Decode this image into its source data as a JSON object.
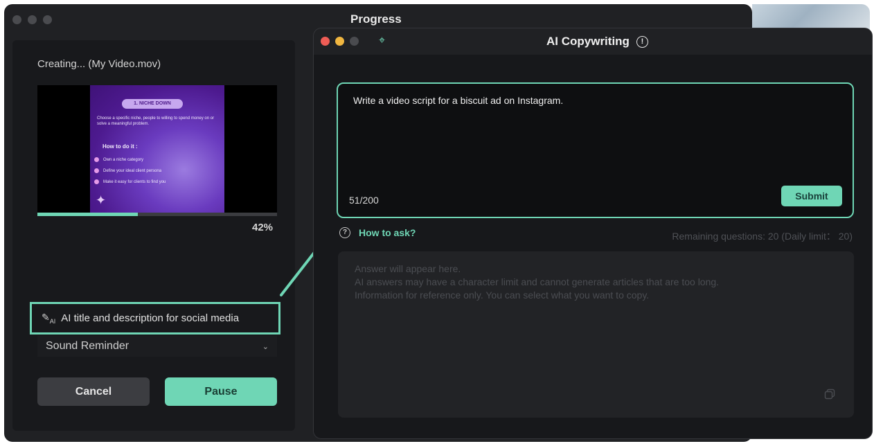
{
  "progress_window": {
    "title": "Progress",
    "creating_label": "Creating... (My Video.mov)",
    "progress_percent": "42%",
    "progress_value": 0.42,
    "preview_slide": {
      "heading": "1. NICHE DOWN",
      "body": "Choose a specific niche, people to willing to spend money on or solve a meaningful problem.",
      "subheading": "How to do it :",
      "bullets": [
        "Own a niche category",
        "Define your ideal client persona",
        "Make it easy for clients to find you"
      ]
    },
    "ai_social_label": "AI title and description for social media",
    "ai_icon_sub": "AI",
    "sound_select_value": "Sound Reminder",
    "cancel_label": "Cancel",
    "pause_label": "Pause"
  },
  "copywriting_window": {
    "title": "AI Copywriting",
    "prompt_text": "Write a video script for a biscuit ad on Instagram.",
    "char_count": "51/200",
    "submit_label": "Submit",
    "how_to_ask_label": "How to ask?",
    "remaining_text": "Remaining questions: 20 (Daily limit： 20)",
    "answer_placeholder": [
      "Answer will appear here.",
      "AI answers may have a character limit and cannot generate articles that are too long.",
      "Information for reference only. You can select what you want to copy."
    ]
  },
  "icons": {
    "info": "!",
    "question": "?",
    "pin": "⌖",
    "chevron": "⌄",
    "pen": "✎"
  },
  "colors": {
    "accent": "#6fd6b5",
    "window_bg": "#202124",
    "panel_bg": "#17181b"
  }
}
